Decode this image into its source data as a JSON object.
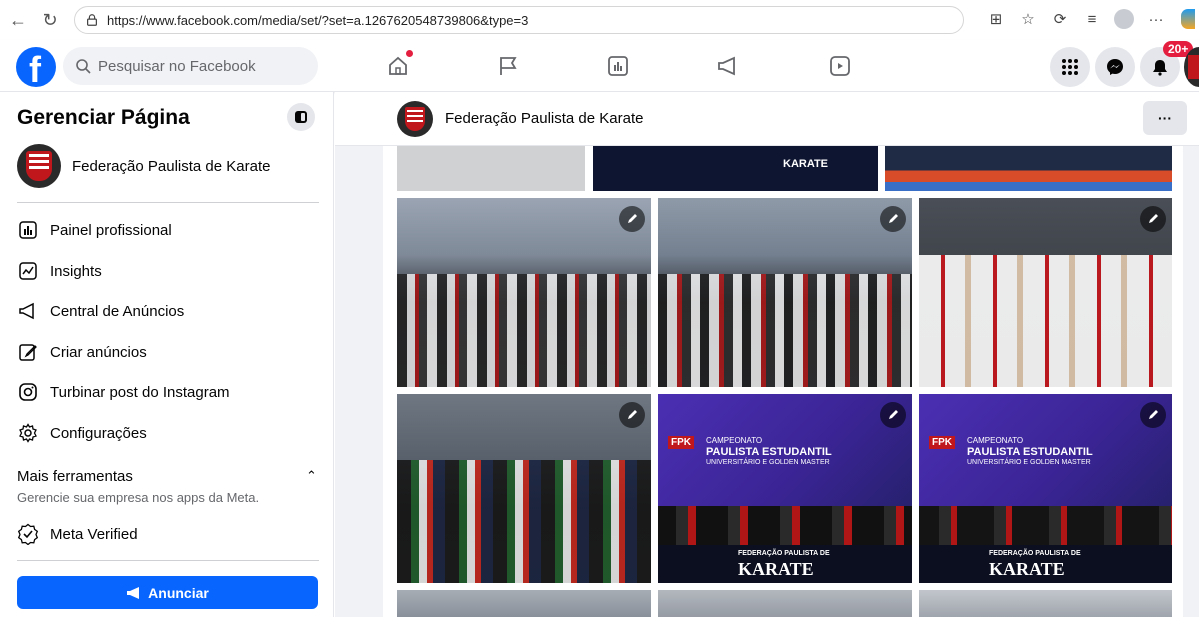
{
  "browser": {
    "url": "https://www.facebook.com/media/set/?set=a.1267620548739806&type=3"
  },
  "topnav": {
    "search_placeholder": "Pesquisar no Facebook",
    "notification_badge": "20+"
  },
  "sidebar": {
    "title": "Gerenciar Página",
    "page_name": "Federação Paulista de Karate",
    "items": [
      {
        "label": "Painel profissional",
        "icon": "dashboard-icon"
      },
      {
        "label": "Insights",
        "icon": "insights-icon"
      },
      {
        "label": "Central de Anúncios",
        "icon": "megaphone-icon"
      },
      {
        "label": "Criar anúncios",
        "icon": "edit-icon"
      },
      {
        "label": "Turbinar post do Instagram",
        "icon": "instagram-icon"
      },
      {
        "label": "Configurações",
        "icon": "gear-icon"
      }
    ],
    "more_tools_title": "Mais ferramentas",
    "more_tools_sub": "Gerencie sua empresa nos apps da Meta.",
    "meta_verified": "Meta Verified",
    "cta_label": "Anunciar"
  },
  "main": {
    "page_name": "Federação Paulista de Karate",
    "more_label": "···",
    "banner_karate": "KARATE",
    "banner_federacao": "FEDERAÇÃO PAULISTA DE",
    "event_title_1": "CAMPEONATO",
    "event_title_2": "PAULISTA ESTUDANTIL",
    "event_title_3": "UNIVERSITÁRIO E GOLDEN MASTER",
    "fpk_logo": "FPK"
  },
  "colors": {
    "brand": "#0866ff",
    "bg": "#f0f2f5",
    "notif": "#e41e3f"
  }
}
